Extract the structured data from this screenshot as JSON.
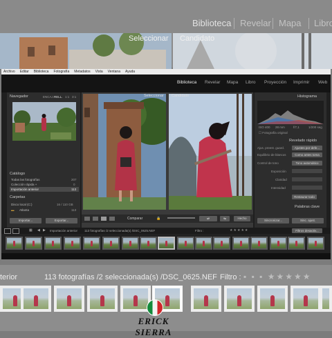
{
  "background": {
    "modules": [
      "Biblioteca",
      "Revelar",
      "Mapa",
      "Libro"
    ],
    "photo_labels": [
      "Seleccionar",
      "Candidato"
    ],
    "status_left": "terior",
    "status_mid": "113 fotografías /2 seleccionada(s) /DSC_0625.NEF",
    "filter_label": "Filtro :"
  },
  "menubar": [
    "Archivo",
    "Editar",
    "Biblioteca",
    "Fotografía",
    "Metadatos",
    "Vista",
    "Ventana",
    "Ayuda"
  ],
  "modules": [
    "Biblioteca",
    "Revelar",
    "Mapa",
    "Libro",
    "Proyección",
    "Imprimir",
    "Web"
  ],
  "navigator": {
    "title": "Navegador",
    "zoom_opts": [
      "ENCAJ.",
      "RELL.",
      "1:1",
      "3:1"
    ]
  },
  "catalog": {
    "title": "Catálogo",
    "items": [
      {
        "label": "Todas las fotografías",
        "count": "207"
      },
      {
        "label": "Colección rápida +",
        "count": "0"
      },
      {
        "label": "Importación anterior",
        "count": "113"
      }
    ]
  },
  "folders": {
    "title": "Carpetas",
    "disk_label": "Disco local (C:)",
    "disk_size": "16 / 110 GB",
    "folder": "Atlanta",
    "folder_count": "113"
  },
  "left_buttons": [
    "Importar...",
    "Exportar..."
  ],
  "center": {
    "left_label": "Seleccionar",
    "right_label": "Candidato",
    "compare": "Comparar",
    "done": "Hecho"
  },
  "right_panel": {
    "histogram": "Histograma",
    "hist_values": [
      "ISO 400",
      "28 mm",
      "f/7,1",
      "1/200 seg"
    ],
    "original": "Fotografía original",
    "quick_dev": "Revelado rápido",
    "preset_label": "Ajus. preest. guard.",
    "preset_value": "Ajustes por defe...",
    "wb_label": "Equilibrio de blancos",
    "wb_value": "Como antes toma",
    "tone_label": "Control de tono",
    "tone_value": "Tono automático",
    "rows": [
      "Exposición",
      "Claridad",
      "Intensidad"
    ],
    "reset": "Restaurar todo",
    "keywords": "Palabras clave",
    "sync_btn": "Sincronizar...",
    "settings_btn": "Sinc. ajust."
  },
  "filmstrip": {
    "pages": [
      "1",
      "2"
    ],
    "source": "Importación anterior",
    "info": "113 fotografías /2 seleccionada(s) /DSC_0625.NEF",
    "filter": "Filtro :",
    "filter_off": "Filtros desactiv..."
  },
  "watermark": "ERICK SIERRA",
  "colors": {
    "accent_dress": "#b23347",
    "sky": "#aebfd1",
    "panel": "#2d2d2d"
  }
}
